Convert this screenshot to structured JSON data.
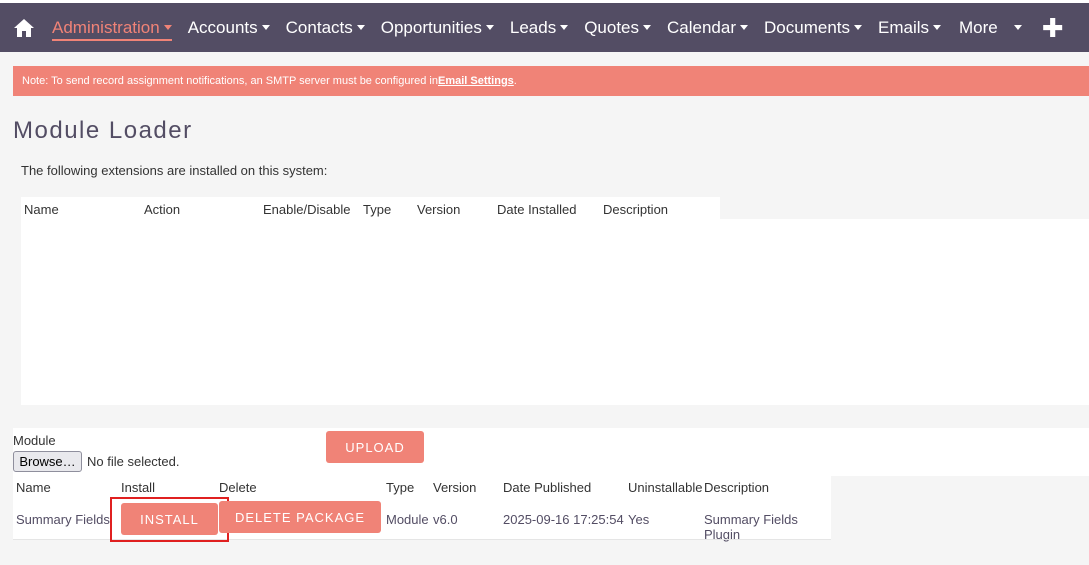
{
  "nav": {
    "items": [
      "Administration",
      "Accounts",
      "Contacts",
      "Opportunities",
      "Leads",
      "Quotes",
      "Calendar",
      "Documents",
      "Emails"
    ],
    "more_label": "More"
  },
  "alert": {
    "prefix": "Note: To send record assignment notifications, an SMTP server must be configured in ",
    "link": "Email Settings",
    "suffix": "."
  },
  "page_title": "Module Loader",
  "installed": {
    "intro": "The following extensions are installed on this system:",
    "columns": [
      "Name",
      "Action",
      "Enable/Disable",
      "Type",
      "Version",
      "Date Installed",
      "Description"
    ]
  },
  "upload": {
    "module_label": "Module",
    "browse_label": "Browse…",
    "file_status": "No file selected.",
    "upload_label": "UPLOAD"
  },
  "packages": {
    "columns": [
      "Name",
      "Install",
      "Delete",
      "Type",
      "Version",
      "Date Published",
      "Uninstallable",
      "Description"
    ],
    "rows": [
      {
        "name": "Summary Fields",
        "install_label": "INSTALL",
        "delete_label": "DELETE PACKAGE",
        "type": "Module",
        "version": "v6.0",
        "date_published": "2025-09-16 17:25:54",
        "uninstallable": "Yes",
        "description": "Summary Fields Plugin"
      }
    ]
  },
  "colors": {
    "nav_bg": "#534d64",
    "accent": "#f08377",
    "highlight": "#e02020"
  }
}
